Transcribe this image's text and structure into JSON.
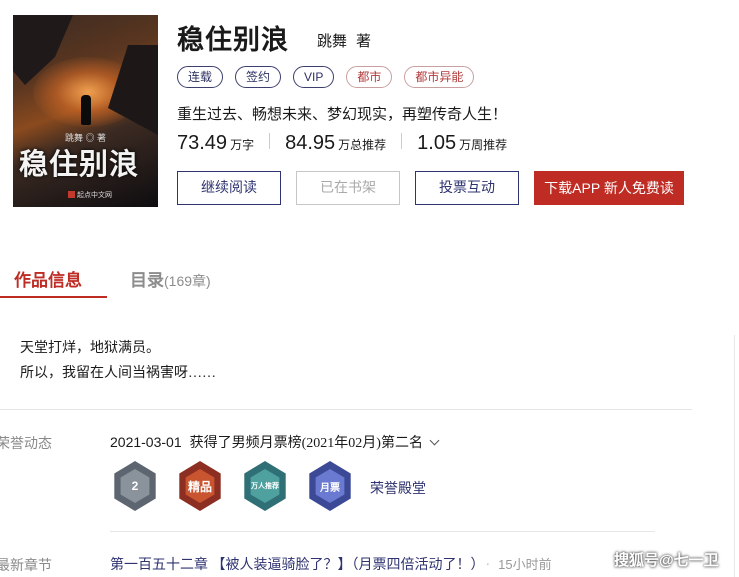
{
  "book": {
    "cover_title": "稳住别浪",
    "cover_author": "跳舞 ◎ 著",
    "cover_publisher": "起点中文网",
    "title": "稳住别浪",
    "author": "跳舞",
    "author_suffix": "著",
    "tags": [
      {
        "label": "连载",
        "style": "blue"
      },
      {
        "label": "签约",
        "style": "blue"
      },
      {
        "label": "VIP",
        "style": "blue"
      },
      {
        "label": "都市",
        "style": "red"
      },
      {
        "label": "都市异能",
        "style": "red"
      }
    ],
    "intro": "重生过去、畅想未来、梦幻现实，再塑传奇人生！",
    "stats": [
      {
        "value": "73.49",
        "unit": "万字"
      },
      {
        "value": "84.95",
        "unit": "万总推荐"
      },
      {
        "value": "1.05",
        "unit": "万周推荐"
      }
    ]
  },
  "actions": {
    "read": "继续阅读",
    "shelf": "已在书架",
    "vote": "投票互动",
    "download": "下载APP 新人免费读"
  },
  "tabs": {
    "info": "作品信息",
    "catalog": "目录",
    "catalog_count": "(169章)"
  },
  "synopsis": [
    "天堂打烊，地狱满员。",
    "所以，我留在人间当祸害呀……"
  ],
  "honor": {
    "label": "荣誉动态",
    "date": "2021-03-01",
    "text": "获得了男频月票榜(2021年02月)第二名",
    "badges": [
      {
        "name": "rank-2-badge",
        "text": "2",
        "outer": "#5d6670",
        "inner": "#8a939c"
      },
      {
        "name": "quality-badge",
        "text": "精品",
        "outer": "#8d2e22",
        "inner": "#c8552f"
      },
      {
        "name": "recommend-badge",
        "text": "万人推荐",
        "outer": "#2f6f76",
        "inner": "#4fa1a0"
      },
      {
        "name": "monthly-ticket-badge",
        "text": "月票",
        "outer": "#3b4996",
        "inner": "#6a7ad0"
      }
    ],
    "hall_label": "荣誉殿堂"
  },
  "latest": {
    "label": "最新章节",
    "chapter": "第一百五十二章 【被人装逼骑脸了？】（月票四倍活动了！）",
    "time": "15小时前"
  },
  "watermark": "搜狐号@七一卫"
}
